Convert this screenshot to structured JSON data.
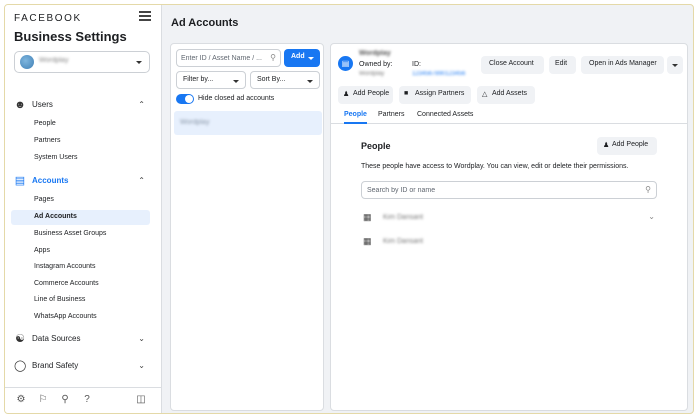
{
  "sidebar": {
    "brand": "FACEBOOK",
    "title": "Business Settings",
    "business_name": "Wordplay",
    "sections": {
      "users": {
        "label": "Users",
        "items": [
          "People",
          "Partners",
          "System Users"
        ]
      },
      "accounts": {
        "label": "Accounts",
        "items": [
          "Pages",
          "Ad Accounts",
          "Business Asset Groups",
          "Apps",
          "Instagram Accounts",
          "Commerce Accounts",
          "Line of Business",
          "WhatsApp Accounts"
        ]
      },
      "data_sources": {
        "label": "Data Sources"
      },
      "brand_safety": {
        "label": "Brand Safety"
      }
    },
    "selected_item": "Ad Accounts"
  },
  "header": {
    "title": "Ad Accounts"
  },
  "list_panel": {
    "search_placeholder": "Enter ID / Asset Name / ...",
    "add_label": "Add",
    "filter_label": "Filter by...",
    "sort_label": "Sort By...",
    "toggle_label": "Hide closed ad accounts",
    "items": [
      "Wordplay"
    ]
  },
  "detail": {
    "account_name": "Wordplay",
    "owned_by_label": "Owned by:",
    "owned_by_value": "Wordplay",
    "id_label": "ID:",
    "id_value": "1234567890123456",
    "buttons": {
      "close": "Close Account",
      "edit": "Edit",
      "ads_manager": "Open in Ads Manager"
    },
    "actions": {
      "add_people": "Add People",
      "assign_partners": "Assign Partners",
      "add_assets": "Add Assets"
    },
    "tabs": [
      "People",
      "Partners",
      "Connected Assets"
    ],
    "people": {
      "title": "People",
      "add_button": "Add People",
      "description": "These people have access to Wordplay. You can view, edit or delete their permissions.",
      "search_placeholder": "Search by ID or name",
      "members": [
        "Kim Dansant",
        "Kim Dansant"
      ]
    }
  }
}
